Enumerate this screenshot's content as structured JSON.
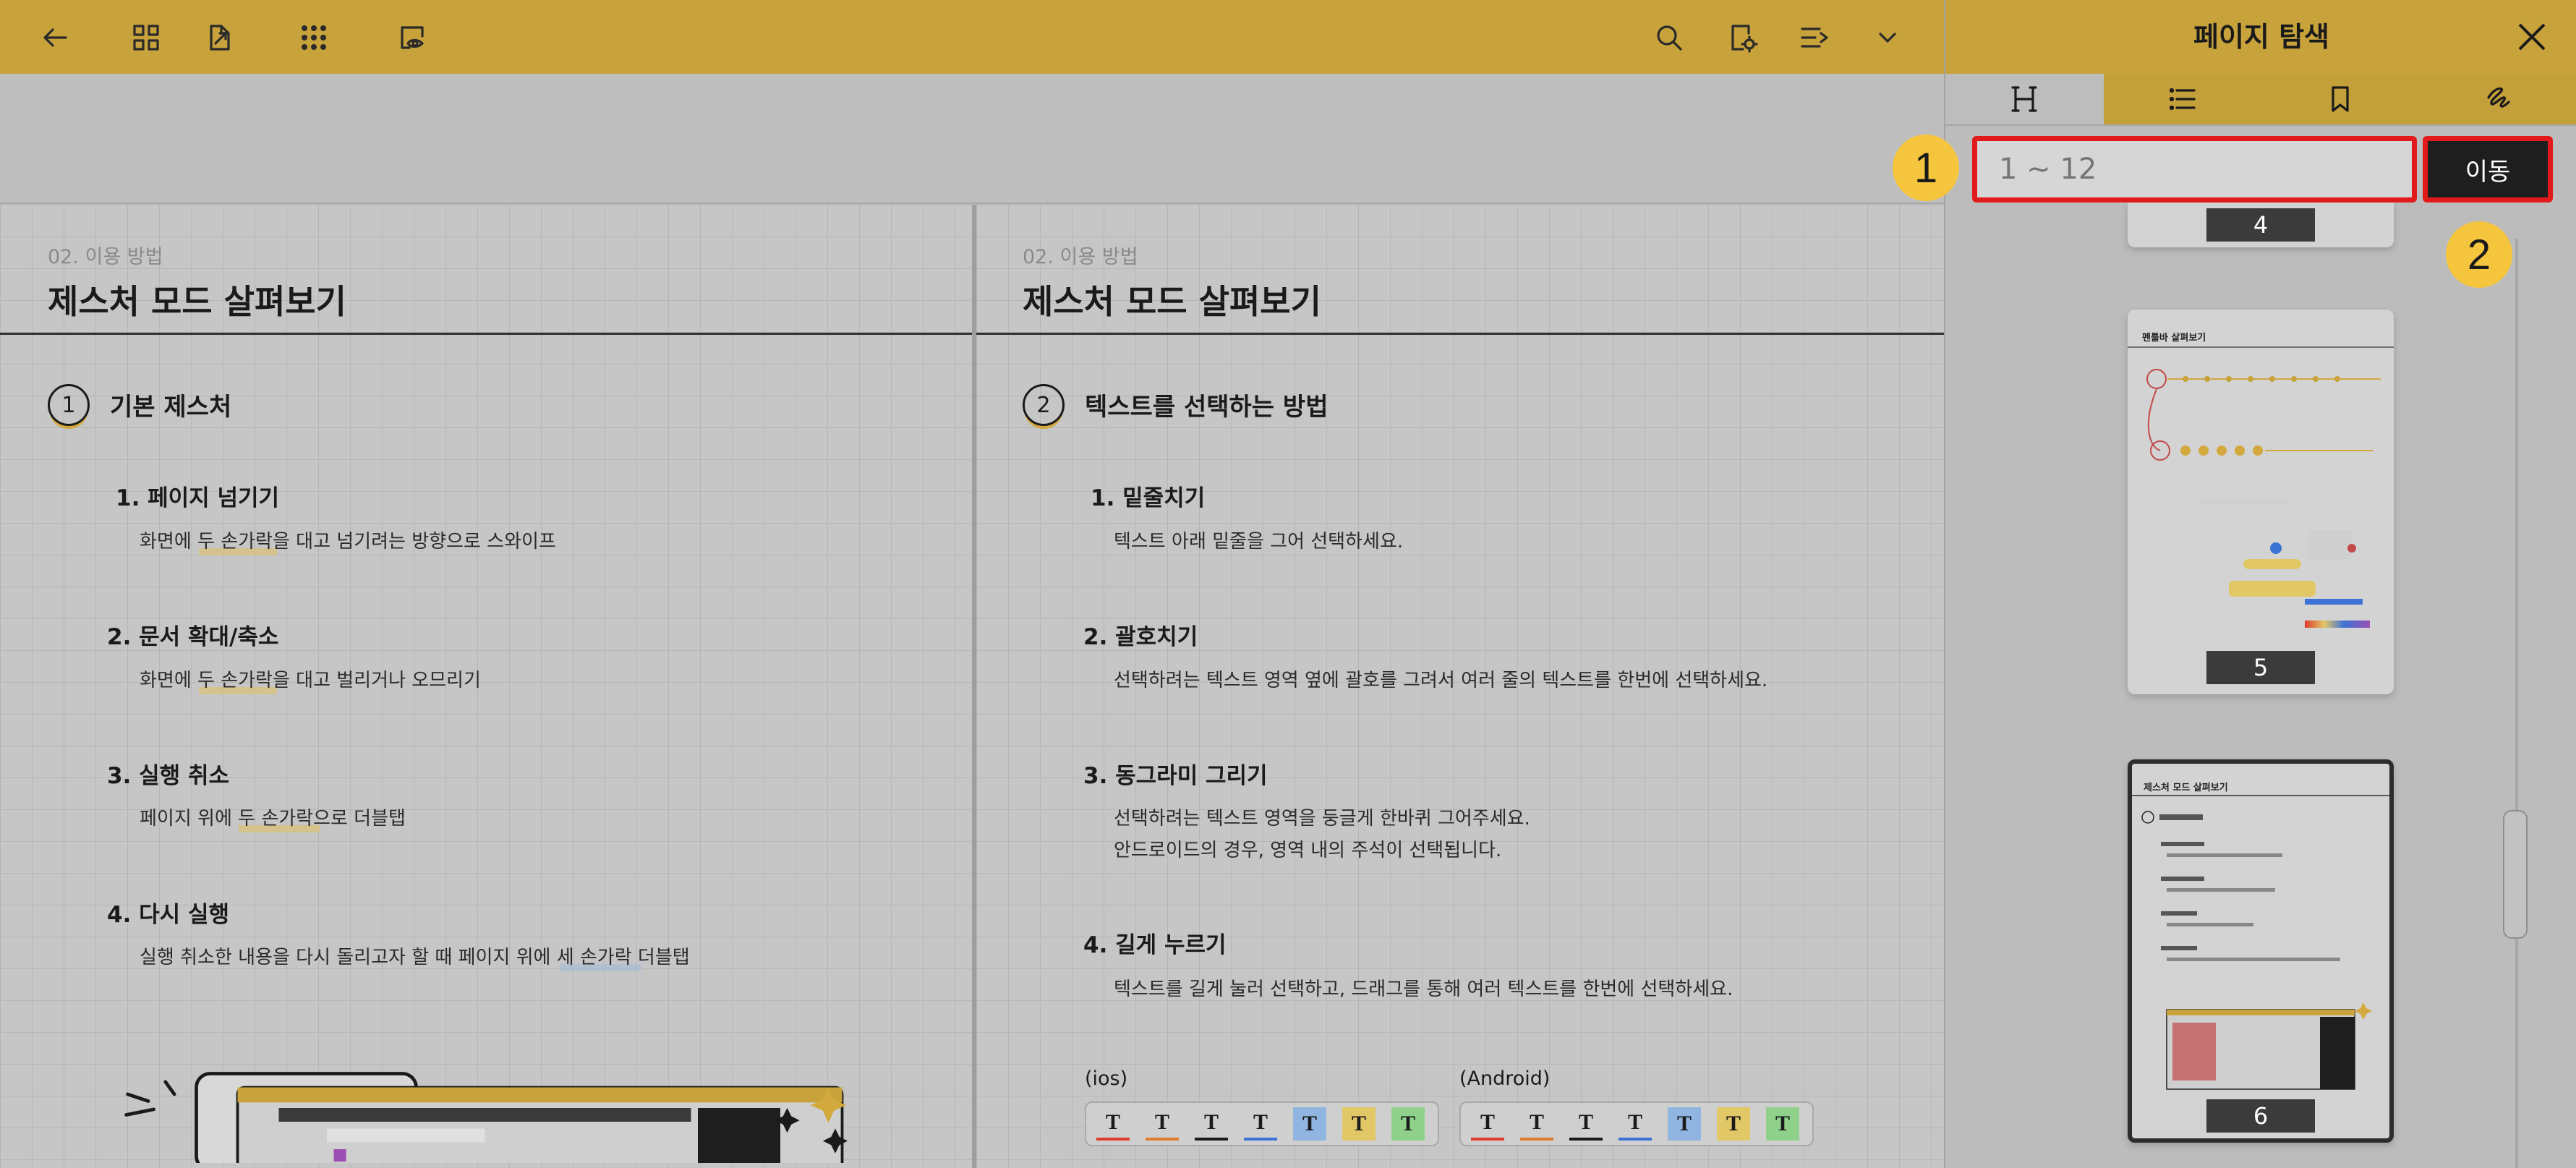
{
  "toolbar": {
    "back": "back-arrow-icon",
    "grid": "grid-view-icon",
    "export": "export-icon",
    "apps": "apps-icon",
    "reading_mode": "reading-mode-icon",
    "search": "search-icon",
    "settings": "page-settings-icon",
    "sort": "list-sort-icon",
    "more": "chevron-down-icon"
  },
  "left_page": {
    "breadcrumb": "02. 이용 방법",
    "title": "제스처 모드 살펴보기",
    "section_number": "1",
    "section_title": "기본 제스처",
    "items": [
      {
        "head": "1. 페이지 넘기기",
        "desc": "화면에 두 손가락을 대고 넘기려는 방향으로 스와이프"
      },
      {
        "head": "2. 문서 확대/축소",
        "desc": "화면에 두 손가락을 대고 벌리거나 오므리기"
      },
      {
        "head": "3. 실행 취소",
        "desc": "페이지 위에 두 손가락으로 더블탭"
      },
      {
        "head": "4. 다시 실행",
        "desc": "실행 취소한 내용을 다시 돌리고자 할 때 페이지 위에 세 손가락 더블탭"
      }
    ]
  },
  "right_page": {
    "breadcrumb": "02. 이용 방법",
    "title": "제스처 모드 살펴보기",
    "section_number": "2",
    "section_title": "텍스트를 선택하는 방법",
    "items": [
      {
        "head": "1. 밑줄치기",
        "desc": "텍스트 아래 밑줄을 그어 선택하세요."
      },
      {
        "head": "2. 괄호치기",
        "desc": "선택하려는 텍스트 영역 옆에 괄호를 그려서 여러 줄의 텍스트를 한번에 선택하세요."
      },
      {
        "head": "3. 동그라미 그리기",
        "desc": "선택하려는 텍스트 영역을 둥글게 한바퀴 그어주세요.",
        "desc2": "안드로이드의 경우, 영역 내의 주석이 선택됩니다."
      },
      {
        "head": "4. 길게 누르기",
        "desc": "텍스트를 길게 눌러 선택하고, 드래그를 통해 여러 텍스트를 한번에 선택하세요."
      }
    ],
    "platforms": [
      "(ios)",
      "(Android)"
    ],
    "chip_letter": "T"
  },
  "panel": {
    "title": "페이지 탐색",
    "close": "close-icon",
    "tabs": [
      "outline-icon",
      "list-icon",
      "bookmark-icon",
      "annotation-icon"
    ],
    "goto_placeholder": "1 ~ 12",
    "goto_button": "이동",
    "callouts": [
      "1",
      "2"
    ],
    "thumbnails": [
      {
        "label": "4"
      },
      {
        "label": "5",
        "title": "펜툴바 살펴보기"
      },
      {
        "label": "6",
        "title": "제스처 모드 살펴보기"
      }
    ]
  },
  "colors": {
    "toolbar": "#c8a23a",
    "highlight": "#e11b1b",
    "callout": "#f6c53e"
  }
}
